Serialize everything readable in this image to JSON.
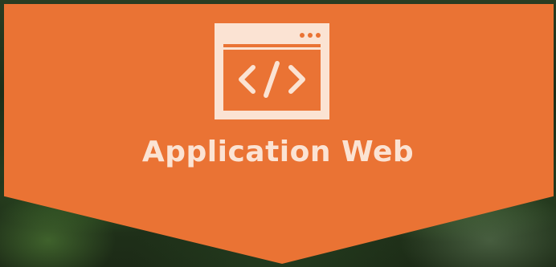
{
  "banner": {
    "title": "Application Web",
    "icon": "code-window-icon",
    "color": "#ea7334",
    "text_color": "#fbe3d3"
  }
}
